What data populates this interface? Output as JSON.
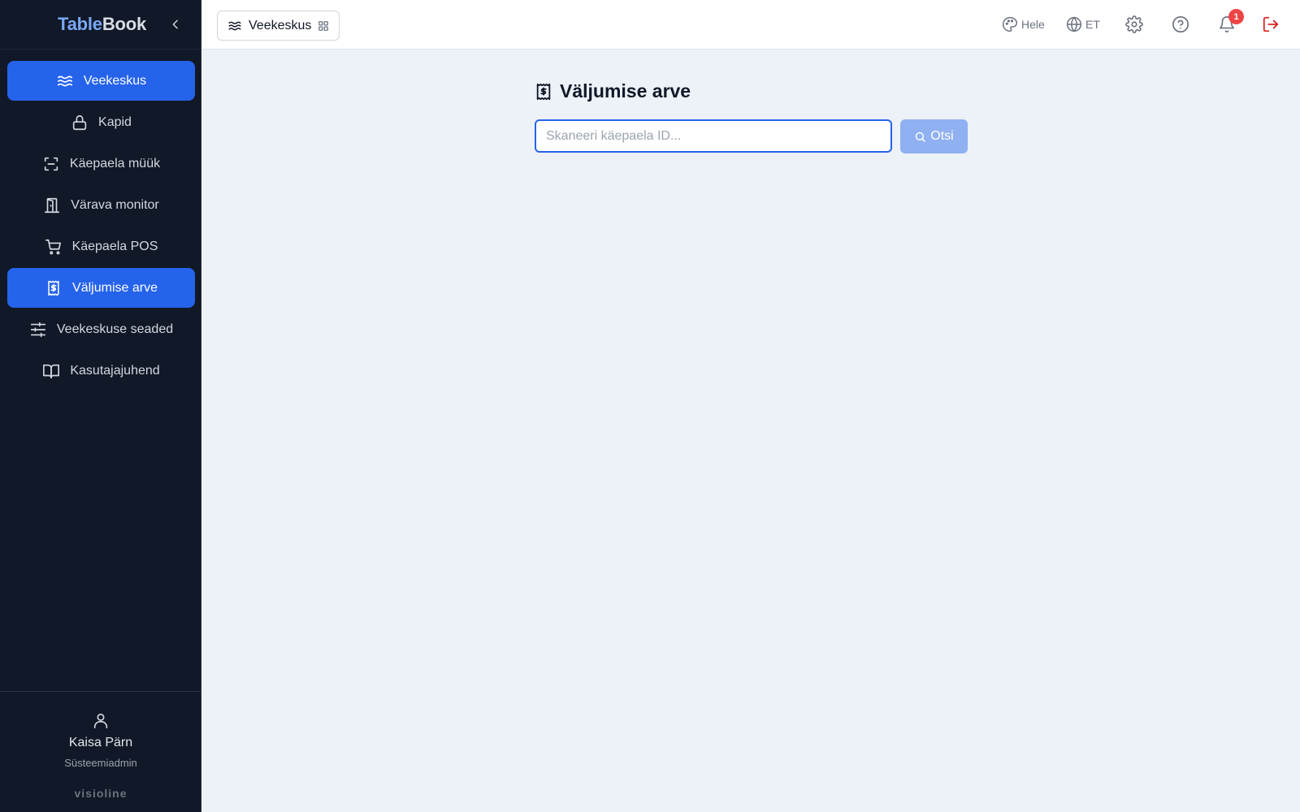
{
  "app": {
    "logo_part1": "Table",
    "logo_part2": "Book"
  },
  "sidebar": {
    "items": [
      {
        "label": "Veekeskus",
        "icon": "waves-icon",
        "active": true
      },
      {
        "label": "Kapid",
        "icon": "lock-icon",
        "active": false
      },
      {
        "label": "Käepaela müük",
        "icon": "scan-icon",
        "active": false
      },
      {
        "label": "Värava monitor",
        "icon": "door-icon",
        "active": false
      },
      {
        "label": "Käepaela POS",
        "icon": "cart-icon",
        "active": false
      },
      {
        "label": "Väljumise arve",
        "icon": "receipt-icon",
        "active": true
      },
      {
        "label": "Veekeskuse seaded",
        "icon": "sliders-icon",
        "active": false
      },
      {
        "label": "Kasutajajuhend",
        "icon": "book-icon",
        "active": false
      }
    ],
    "user": {
      "name": "Kaisa Pärn",
      "role": "Süsteemiadmin"
    },
    "brand": "visioline"
  },
  "topbar": {
    "module": "Veekeskus",
    "theme_label": "Hele",
    "language_label": "ET",
    "notification_count": "1"
  },
  "main": {
    "title": "Väljumise arve",
    "search": {
      "placeholder": "Skaneeri käepaela ID...",
      "value": "",
      "button_label": "Otsi"
    }
  },
  "colors": {
    "primary": "#2563eb",
    "sidebar_bg": "#111827",
    "page_bg": "#edf1f8",
    "danger": "#dc2626",
    "button_disabled": "#8fb0f1"
  }
}
